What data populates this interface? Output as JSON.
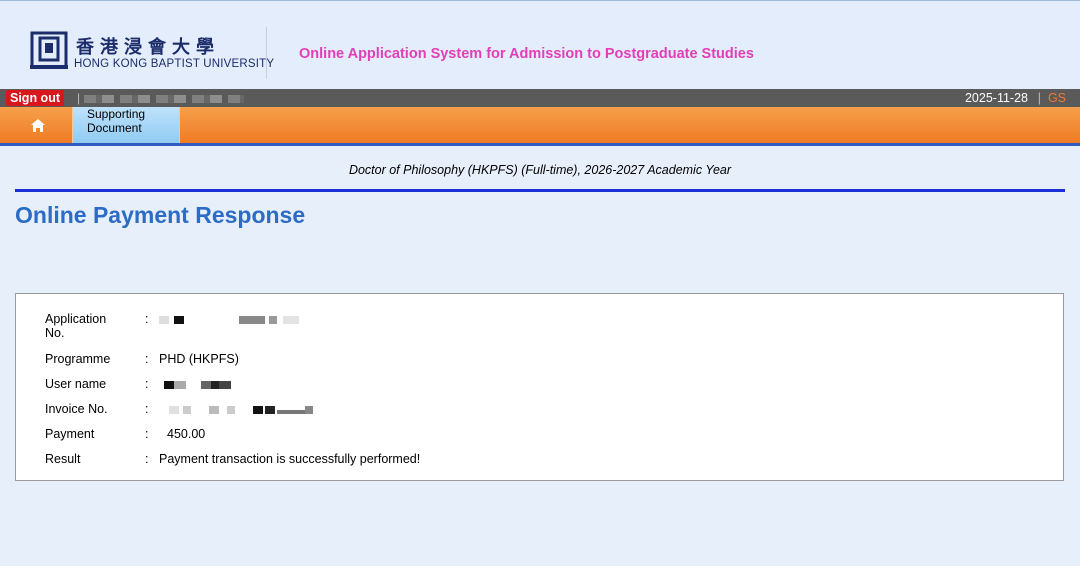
{
  "header": {
    "logo_cn": "香港浸會大學",
    "logo_en": "HONG KONG BAPTIST UNIVERSITY",
    "system_title": "Online Application System for Admission to Postgraduate Studies"
  },
  "topbar": {
    "signout_label": "Sign out",
    "separator": "|",
    "date": "2025-11-28",
    "pipe": "|",
    "gs": "GS"
  },
  "nav": {
    "home_icon": "home-icon",
    "tab_label": "Supporting Document"
  },
  "main": {
    "programme_title": "Doctor of Philosophy (HKPFS) (Full-time), 2026-2027 Academic Year",
    "page_title": "Online Payment Response",
    "rows": [
      {
        "label": "Application No.",
        "value": ""
      },
      {
        "label": "Programme",
        "value": "PHD (HKPFS)"
      },
      {
        "label": "User name",
        "value": ""
      },
      {
        "label": "Invoice No.",
        "value": ""
      },
      {
        "label": "Payment",
        "value": "450.00"
      },
      {
        "label": "Result",
        "value": "Payment transaction is successfully performed!"
      }
    ],
    "colon": ":"
  },
  "colors": {
    "accent_pink": "#e23eb7",
    "title_blue": "#2c6cc6",
    "signout_red": "#d7171c",
    "nav_orange": "#ee7c24"
  }
}
